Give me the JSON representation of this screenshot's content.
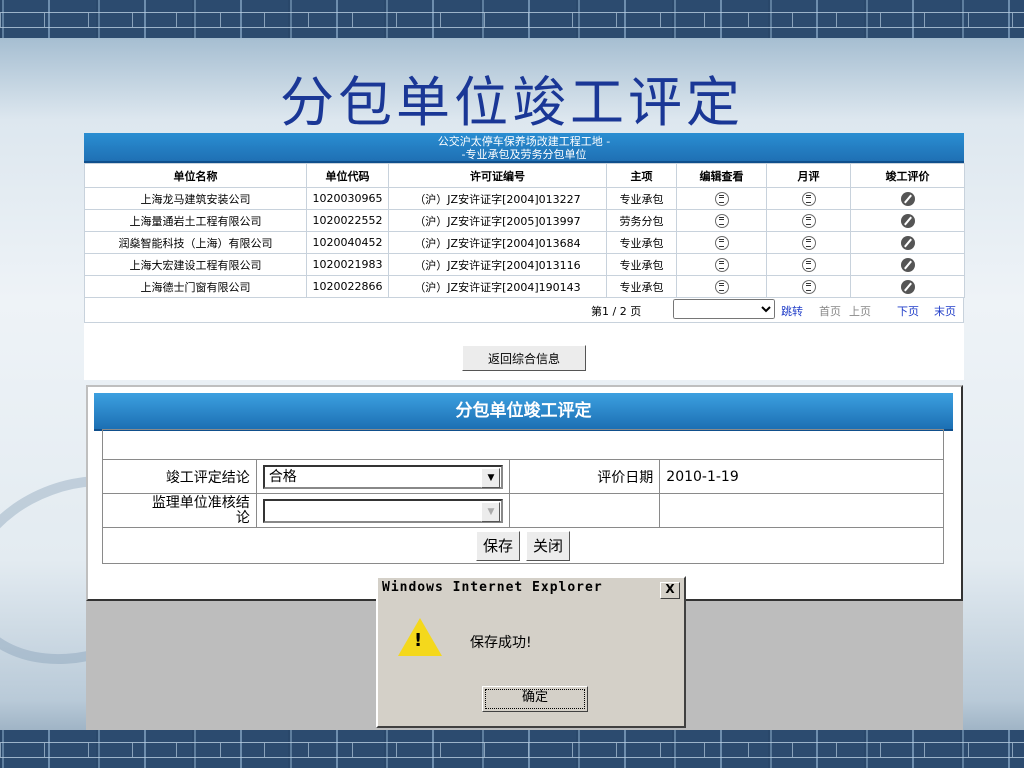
{
  "slide_title": "分包单位竣工评定",
  "list_panel": {
    "header_line1": "公交沪太停车保养场改建工程工地 -",
    "header_line2": "-专业承包及劳务分包单位",
    "columns": [
      "单位名称",
      "单位代码",
      "许可证编号",
      "主项",
      "编辑查看",
      "月评",
      "竣工评价"
    ],
    "rows": [
      {
        "name": "上海龙马建筑安装公司",
        "code": "1020030965",
        "license": "（沪）JZ安许证字[2004]013227",
        "type": "专业承包"
      },
      {
        "name": "上海量通岩土工程有限公司",
        "code": "1020022552",
        "license": "（沪）JZ安许证字[2005]013997",
        "type": "劳务分包"
      },
      {
        "name": "润燊智能科技（上海）有限公司",
        "code": "1020040452",
        "license": "（沪）JZ安许证字[2004]013684",
        "type": "专业承包"
      },
      {
        "name": "上海大宏建设工程有限公司",
        "code": "1020021983",
        "license": "（沪）JZ安许证字[2004]013116",
        "type": "专业承包"
      },
      {
        "name": "上海德士门窗有限公司",
        "code": "1020022866",
        "license": "（沪）JZ安许证字[2004]190143",
        "type": "专业承包"
      }
    ],
    "pager": {
      "text": "第1 / 2 页",
      "jump": "跳转",
      "first": "首页",
      "prev": "上页",
      "next": "下页",
      "last": "末页"
    },
    "back_button": "返回综合信息",
    "colors": {
      "header": "#1f70b4",
      "link": "#1f3cc8"
    }
  },
  "form_panel": {
    "title": "分包单位竣工评定",
    "label_conclusion": "竣工评定结论",
    "conclusion_value": "合格",
    "label_date": "评价日期",
    "date_value": "2010-1-19",
    "label_supervisor_line1": "监理单位准核结",
    "label_supervisor_line2": "论",
    "supervisor_value": "",
    "save": "保存",
    "close": "关闭"
  },
  "dialog": {
    "title": "Windows Internet Explorer",
    "close": "X",
    "message": "保存成功!",
    "ok": "确定",
    "icon": "warning-icon"
  }
}
